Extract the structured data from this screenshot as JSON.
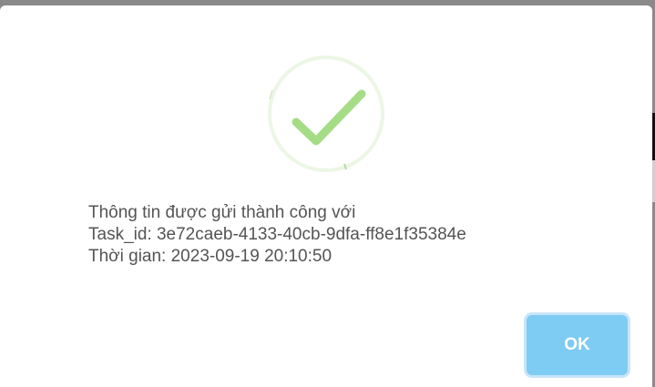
{
  "dialog": {
    "icon": "success-check-icon",
    "message_lines": [
      "Thông tin được gửi thành công với",
      "Task_id: 3e72caeb-4133-40cb-9dfa-ff8e1f35384e",
      "Thời gian: 2023-09-19 20:10:50"
    ],
    "ok_label": "OK"
  },
  "colors": {
    "check": "#a5dc86",
    "ring": "#ecf6e5",
    "button": "#7ecbf4",
    "text": "#545454"
  }
}
